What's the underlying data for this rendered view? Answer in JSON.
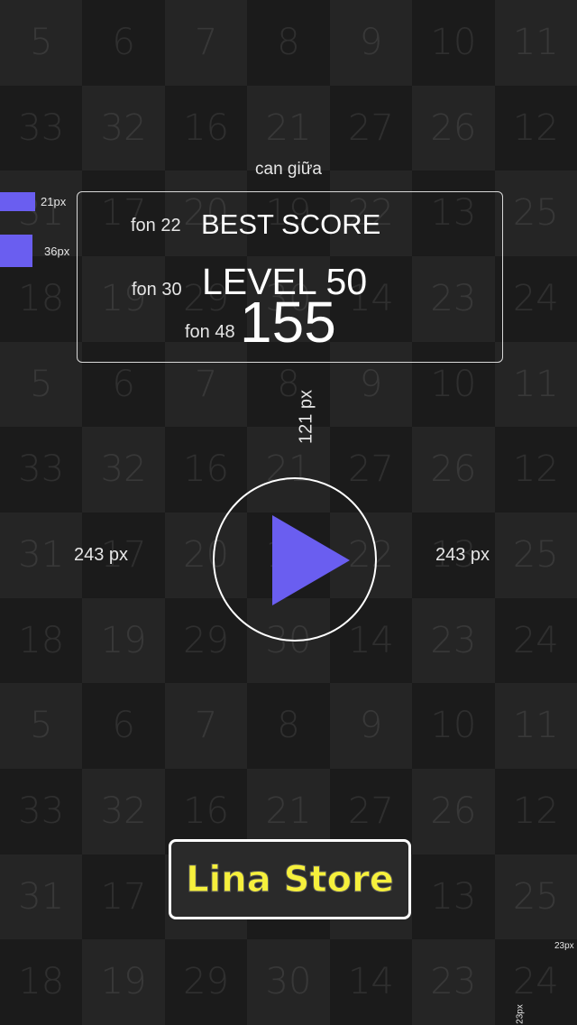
{
  "background": {
    "rows": [
      [
        "5",
        "6",
        "7",
        "8",
        "9",
        "10",
        "11"
      ],
      [
        "33",
        "32",
        "16",
        "21",
        "27",
        "26",
        "12"
      ],
      [
        "31",
        "17",
        "20",
        "19",
        "22",
        "13",
        "25"
      ],
      [
        "18",
        "19",
        "29",
        "30",
        "14",
        "23",
        "24"
      ],
      [
        "5",
        "6",
        "7",
        "8",
        "9",
        "10",
        "11"
      ],
      [
        "33",
        "32",
        "16",
        "21",
        "27",
        "26",
        "12"
      ],
      [
        "31",
        "17",
        "20",
        "19",
        "22",
        "13",
        "25"
      ],
      [
        "18",
        "19",
        "29",
        "30",
        "14",
        "23",
        "24"
      ],
      [
        "5",
        "6",
        "7",
        "8",
        "9",
        "10",
        "11"
      ],
      [
        "33",
        "32",
        "16",
        "21",
        "27",
        "26",
        "12"
      ],
      [
        "31",
        "17",
        "20",
        "19",
        "22",
        "13",
        "25"
      ],
      [
        "18",
        "19",
        "29",
        "30",
        "14",
        "23",
        "24"
      ]
    ]
  },
  "annotations": {
    "center_note": "can giữa",
    "swatch_small_label": "21px",
    "swatch_large_label": "36px",
    "font22_label": "fon 22",
    "font30_label": "fon 30",
    "font48_label": "fon 48",
    "vertical_gap_label": "121 px",
    "left_margin_label": "243 px",
    "right_margin_label": "243 px",
    "corner_label_a": "23px",
    "corner_label_b": "23px"
  },
  "score_panel": {
    "title": "BEST SCORE",
    "level": "LEVEL 50",
    "score": "155"
  },
  "play_button": {
    "icon": "play-icon"
  },
  "store_button": {
    "label": "Lina Store"
  },
  "colors": {
    "accent": "#6a5ef0",
    "store_text": "#f6f03c",
    "background": "#1e1e1e"
  }
}
